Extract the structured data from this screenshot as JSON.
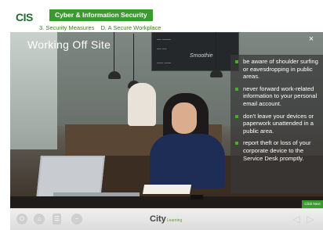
{
  "header": {
    "logo": "CIS",
    "course_title": "Cyber & Information Security",
    "breadcrumb": {
      "step_a": "3. Security Measures",
      "step_b": "D. A Secure Workplace"
    }
  },
  "slide": {
    "title": "Working Off Site",
    "close_icon": "×",
    "board_text": [
      "–– ––––",
      "–– ––",
      "Smoothie",
      "––– –––"
    ],
    "bullets": [
      "be aware of shoulder surfing or eavesdropping in public areas.",
      "never forward work-related information to your personal email account.",
      "don't leave your devices or paperwork unattended in a public area.",
      "report theft or loss of your corporate device to the Service Desk promptly."
    ],
    "click_next": "Click Next"
  },
  "footer": {
    "brand": "City",
    "brand_sub": "Learning",
    "buttons": [
      "power-icon",
      "home-icon",
      "document-icon",
      "minus-icon"
    ],
    "prev_icon": "◁",
    "next_icon": "▷"
  },
  "colors": {
    "accent_green": "#3b9a2f",
    "panel_bg": "#373737"
  }
}
